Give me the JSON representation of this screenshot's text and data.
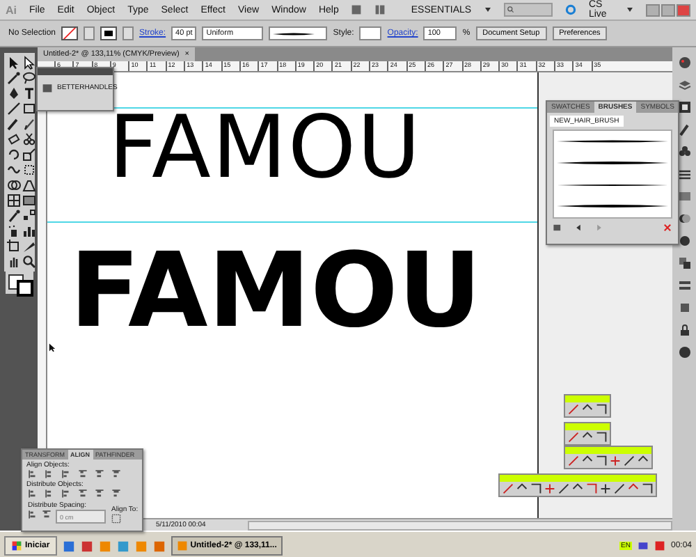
{
  "menu_bar": {
    "logo": "Ai",
    "menus": [
      "File",
      "Edit",
      "Object",
      "Type",
      "Select",
      "Effect",
      "View",
      "Window",
      "Help"
    ],
    "workspace": "ESSENTIALS",
    "cs_live": "CS Live"
  },
  "control_bar": {
    "selection": "No Selection",
    "stroke_label": "Stroke:",
    "stroke_weight": "40 pt",
    "profile": "Uniform",
    "style_label": "Style:",
    "opacity_label": "Opacity:",
    "opacity": "100",
    "percent": "%",
    "buttons": [
      "Document Setup",
      "Preferences"
    ]
  },
  "document_tab": {
    "title": "Untitled-2* @ 133,11% (CMYK/Preview)",
    "close": "×"
  },
  "ruler": [
    "6",
    "7",
    "8",
    "9",
    "10",
    "11",
    "12",
    "13",
    "14",
    "15",
    "16",
    "17",
    "18",
    "19",
    "20",
    "21",
    "22",
    "23",
    "24",
    "25",
    "26",
    "27",
    "28",
    "29",
    "30",
    "31",
    "32",
    "33",
    "34",
    "35"
  ],
  "canvas": {
    "texts": [
      {
        "text": "FAMOU",
        "kind": "thin"
      },
      {
        "text": "FAMOU",
        "kind": "bold"
      }
    ]
  },
  "betterhandles_panel": {
    "title": "BETTERHANDLES"
  },
  "brushes_panel": {
    "tabs": [
      {
        "label": "SWATCHES",
        "selected": false
      },
      {
        "label": "BRUSHES",
        "selected": true
      },
      {
        "label": "SYMBOLS",
        "selected": false
      }
    ],
    "library": "NEW_HAIR_BRUSH"
  },
  "align_panel": {
    "tabs": [
      {
        "label": "TRANSFORM",
        "selected": false
      },
      {
        "label": "ALIGN",
        "selected": true
      },
      {
        "label": "PATHFINDER",
        "selected": false
      }
    ],
    "sections": [
      "Align Objects:",
      "Distribute Objects:",
      "Distribute Spacing:"
    ],
    "spacing_placeholder": "0 cm",
    "align_to": "Align To:"
  },
  "status_bar": {
    "date": "5/11/2010 00:04"
  },
  "taskbar": {
    "start": "Iniciar",
    "task": "Untitled-2* @ 133,11...",
    "language": "EN",
    "clock": "00:04"
  }
}
